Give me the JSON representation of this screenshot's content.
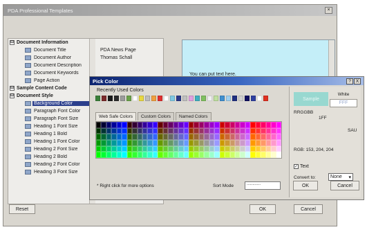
{
  "window": {
    "title": "PDA Professional Templates",
    "close_glyph": "×"
  },
  "tree": {
    "doc_info_header": "Document Information",
    "doc_info": [
      {
        "label": "Document Title",
        "value": "PDA News Page"
      },
      {
        "label": "Document Author",
        "value": "Thomas Schall"
      },
      {
        "label": "Document Description",
        "value": ""
      },
      {
        "label": "Document Keywords",
        "value": ""
      },
      {
        "label": "Page Action",
        "value": ""
      }
    ],
    "sample_header": "Sample Content Code",
    "style_header": "Document Style",
    "style_items": [
      "Background Color",
      "Paragraph Font Color",
      "Paragraph Font Size",
      "Heading 1 Font Size",
      "Heading 1 Bold",
      "Heading 1 Font Color",
      "Heading 2 Font Size",
      "Heading 2 Bold",
      "Heading 2 Font Color",
      "Heading 3 Font Size"
    ],
    "expand_glyph": "⊟"
  },
  "preview": {
    "text": "You can put text here."
  },
  "buttons": {
    "reset": "Reset",
    "ok": "OK",
    "cancel": "Cancel"
  },
  "picker": {
    "title": "Pick Color",
    "help_glyph": "?",
    "close_glyph": "X",
    "recent_label": "Recently Used Colors",
    "recent_colors": [
      "#3a7f3a",
      "#7b2b2b",
      "#1b1b1b",
      "#2c2c2c",
      "#9c9c9c",
      "#6aa24a",
      "#ffffff",
      "#e8d840",
      "#bdbdbd",
      "#f0a040",
      "#e03030",
      "#ffffff",
      "#7ec8e3",
      "#2a3a8a",
      "#c0c0c0",
      "#e0a0e0",
      "#40b0c0",
      "#80c060",
      "#f0f0f0",
      "#c0e0a0",
      "#4090d0",
      "#a0d0f0",
      "#203080",
      "#d0d0d0",
      "#101060",
      "#3040a0",
      "#ffffff",
      "#e03020"
    ],
    "tabs": [
      "Web Safe Colors",
      "Custom Colors",
      "Named Colors"
    ],
    "hint": "* Right click for more options",
    "sort_mode_label": "Sort Mode",
    "sort_mode_value": "............",
    "sample_label": "Sample",
    "sample_color": "#98d8d0",
    "white_label": "White",
    "white_value": "FFF",
    "hex_label": "RRGGBB",
    "hex_value": "1FF",
    "pair_label": "SAU",
    "rgb_label": "RGB: 153, 204, 204",
    "text_check": "Text",
    "convert_label": "Convert to:",
    "convert_value": "None",
    "ok": "OK",
    "cancel": "Cancel"
  }
}
